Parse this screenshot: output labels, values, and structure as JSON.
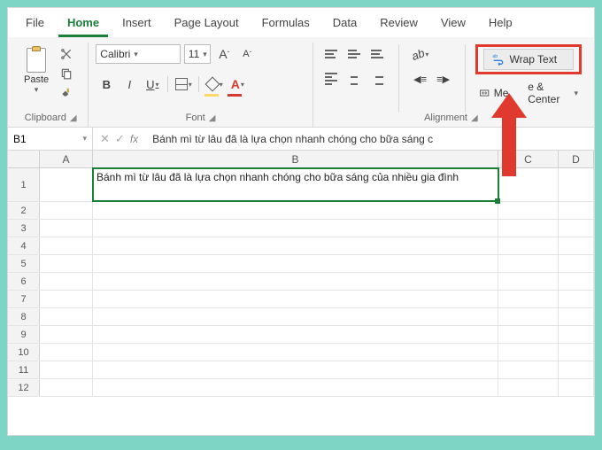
{
  "tabs": {
    "file": "File",
    "home": "Home",
    "insert": "Insert",
    "pagelayout": "Page Layout",
    "formulas": "Formulas",
    "data": "Data",
    "review": "Review",
    "view": "View",
    "help": "Help"
  },
  "clipboard": {
    "paste": "Paste",
    "group": "Clipboard"
  },
  "font": {
    "name": "Calibri",
    "size": "11",
    "bold": "B",
    "italic": "I",
    "underline": "U",
    "group": "Font",
    "incA": "A",
    "decA": "A"
  },
  "alignment": {
    "wrap": "Wrap Text",
    "merge": "Merge & Center",
    "group": "Alignment"
  },
  "namebox": "B1",
  "formula": "Bánh mì từ lâu đã là lựa chọn nhanh chóng cho bữa sáng c",
  "cols": {
    "A": "A",
    "B": "B",
    "C": "C",
    "D": "D"
  },
  "rows": [
    "1",
    "2",
    "3",
    "4",
    "5",
    "6",
    "7",
    "8",
    "9",
    "10",
    "11",
    "12"
  ],
  "cellB1": "Bánh mì từ lâu đã là lựa chọn nhanh chóng cho bữa sáng của nhiều gia đình"
}
